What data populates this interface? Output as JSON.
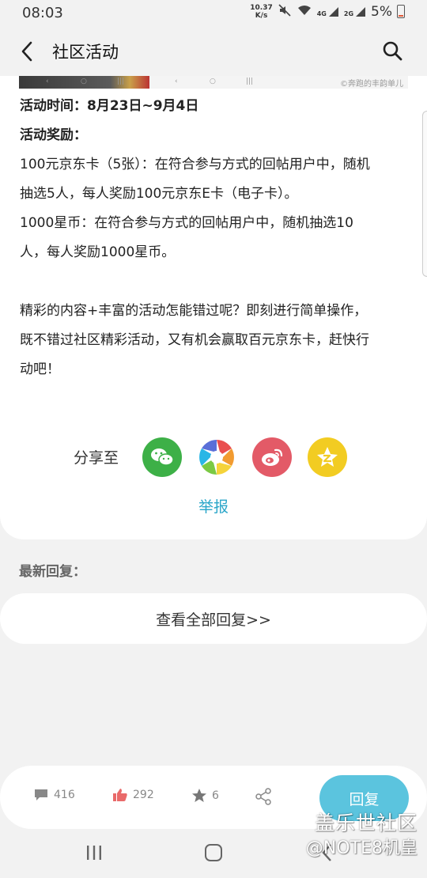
{
  "status_bar": {
    "time": "08:03",
    "net_speed_value": "10.37",
    "net_speed_unit": "K/s",
    "signal1": "4G",
    "signal2": "2G",
    "battery": "5%"
  },
  "app_bar": {
    "title": "社区活动"
  },
  "article": {
    "time_label": "活动时间：8月23日~9月4日",
    "reward_label": "活动奖励：",
    "reward1_line1": "100元京东卡（5张）：在符合参与方式的回帖用户中，随机",
    "reward1_line2": "抽选5人，每人奖励100元京东E卡（电子卡）。",
    "reward2_line1": "1000星币：在符合参与方式的回帖用户中，随机抽选10",
    "reward2_line2": "人，每人奖励1000星币。",
    "promo_line1": "精彩的内容+丰富的活动怎能错过呢？即刻进行简单操作，",
    "promo_line2": "既不错过社区精彩活动，又有机会赢取百元京东卡，赶快行",
    "promo_line3": "动吧！"
  },
  "image_caption": "©奔跑的丰韵单儿",
  "share": {
    "label": "分享至",
    "report": "举报"
  },
  "replies": {
    "latest_label": "最新回复：",
    "view_all": "查看全部回复>>"
  },
  "bottom_bar": {
    "comments": "416",
    "likes": "292",
    "stars": "6",
    "reply_button": "回复"
  },
  "watermark": {
    "line1": "盖乐世社区",
    "line2": "@NOTE8机皇"
  },
  "colors": {
    "accent": "#2aa6c9",
    "reply_button": "#5bc4de",
    "wechat": "#3db047",
    "weibo": "#e35a67",
    "qzone": "#f2cc22"
  }
}
